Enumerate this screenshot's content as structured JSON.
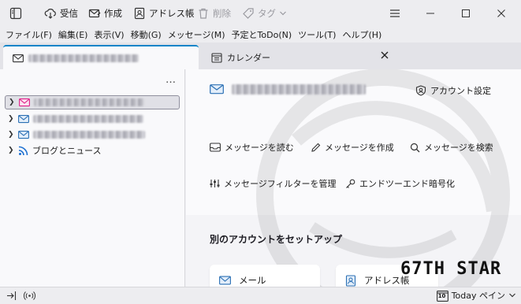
{
  "toolbar": {
    "get_messages": "受信",
    "write": "作成",
    "address_book": "アドレス帳",
    "delete": "削除",
    "tag": "タグ"
  },
  "menubar": [
    "ファイル(F)",
    "編集(E)",
    "表示(V)",
    "移動(G)",
    "メッセージ(M)",
    "予定とToDo(N)",
    "ツール(T)",
    "ヘルプ(H)"
  ],
  "tabs": {
    "calendar": "カレンダー"
  },
  "folder_pane": {
    "more": "…",
    "feeds_label": "ブログとニュース"
  },
  "account_central": {
    "settings": "アカウント設定",
    "actions": {
      "read": "メッセージを読む",
      "compose": "メッセージを作成",
      "search": "メッセージを検索",
      "filters": "メッセージフィルターを管理",
      "e2e": "エンドツーエンド暗号化"
    },
    "setup_title": "別のアカウントをセットアップ",
    "cards": {
      "mail": "メール",
      "address_book": "アドレス帳"
    }
  },
  "overlay": {
    "brand": "67TH STAR"
  },
  "statusbar": {
    "today_pane": "Today ペイン",
    "calendar_day": "10"
  },
  "colors": {
    "accent": "#0a84c8",
    "mail_icon": "#2a6fb4",
    "feed_icon": "#1c6fd1",
    "selected_folder_icon": "#e0218a"
  }
}
